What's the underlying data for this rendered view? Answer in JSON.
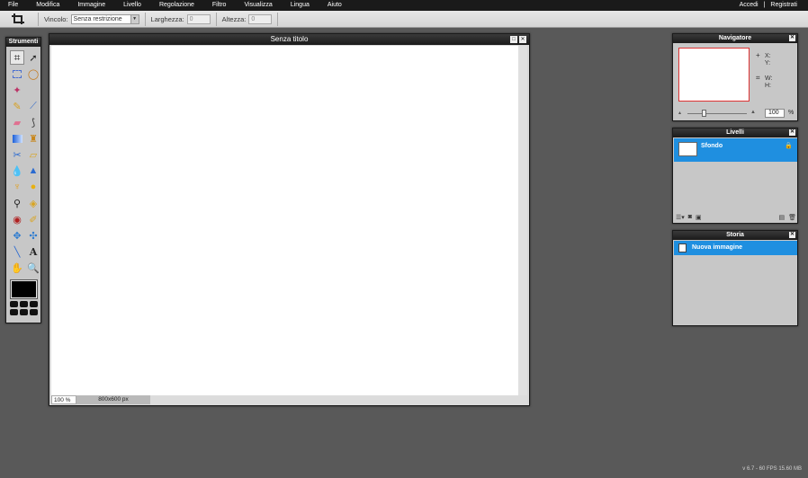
{
  "menu": [
    "File",
    "Modifica",
    "Immagine",
    "Livello",
    "Regolazione",
    "Filtro",
    "Visualizza",
    "Lingua",
    "Aiuto"
  ],
  "account": {
    "login": "Accedi",
    "separator": "|",
    "register": "Registrati"
  },
  "options": {
    "constraint_label": "Vincolo:",
    "constraint_value": "Senza restrizione",
    "width_label": "Larghezza:",
    "width_value": "0",
    "height_label": "Altezza:",
    "height_value": "0"
  },
  "tools": {
    "title": "Strumenti",
    "items": [
      "crop-icon",
      "move-icon",
      "marquee-icon",
      "lasso-icon",
      "wand-icon",
      "pencil-icon",
      "brush-icon",
      "eraser-icon",
      "replace-color-icon",
      "gradient-icon",
      "stamp-icon",
      "sharpen-icon",
      "fill-icon",
      "drop-icon",
      "triangle-icon",
      "dodge-icon",
      "burn-icon",
      "magnify-icon",
      "sponge-icon",
      "redeye-icon",
      "spotheal-icon",
      "bloat-icon",
      "pinch-icon",
      "line-icon",
      "text-icon",
      "hand-icon",
      "zoom-icon"
    ],
    "foreground_color": "#000000"
  },
  "document": {
    "title": "Senza titolo",
    "zoom": "100",
    "zoom_unit": "%",
    "size": "800x600 px"
  },
  "navigator": {
    "title": "Navigatore",
    "x_label": "X:",
    "y_label": "Y:",
    "w_label": "W:",
    "h_label": "H:",
    "zoom_value": "100",
    "zoom_unit": "%"
  },
  "layers": {
    "title": "Livelli",
    "items": [
      {
        "name": "Sfondo"
      }
    ]
  },
  "history": {
    "title": "Storia",
    "items": [
      {
        "name": "Nuova immagine"
      }
    ]
  },
  "status": {
    "fps": "v 6.7 - 60 FPS 15.60 MB"
  },
  "colors": {
    "accent": "#1f8fe0",
    "workspace": "#595959",
    "menubar": "#1a1a1a"
  }
}
